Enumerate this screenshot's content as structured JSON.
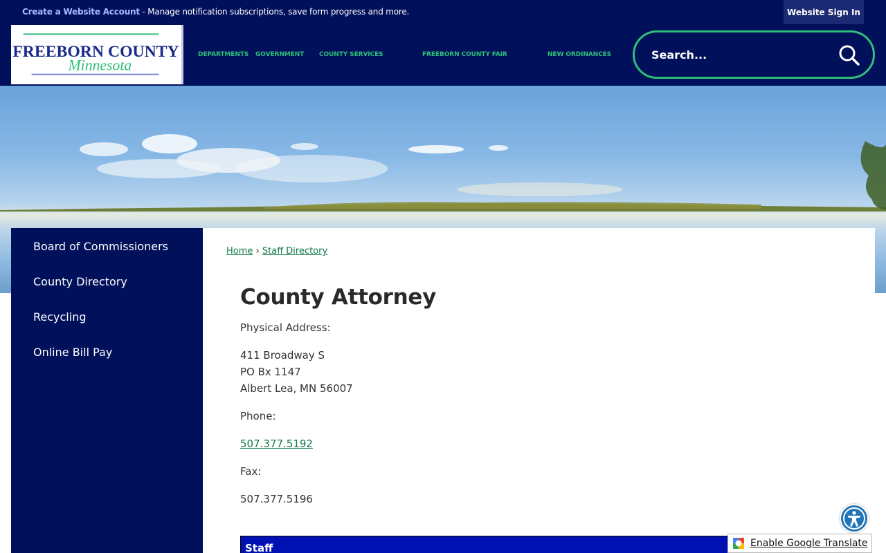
{
  "topbar": {
    "create_account": "Create a Website Account",
    "message": " - Manage notification subscriptions, save form progress and more.",
    "sign_in": "Website Sign In"
  },
  "logo": {
    "line1": "FREEBORN COUNTY",
    "line2": "Minnesota"
  },
  "nav": {
    "items": [
      "DEPARTMENTS",
      "GOVERNMENT",
      "COUNTY SERVICES",
      "FREEBORN COUNTY FAIR",
      "NEW ORDINANCES"
    ]
  },
  "search": {
    "placeholder": "Search..."
  },
  "sidebar": {
    "items": [
      {
        "label": "Board of Commissioners"
      },
      {
        "label": "County Directory"
      },
      {
        "label": "Recycling"
      },
      {
        "label": "Online Bill Pay"
      }
    ]
  },
  "breadcrumb": {
    "home": "Home",
    "separator": "›",
    "current": "Staff Directory"
  },
  "page": {
    "title": "County Attorney",
    "physical_address_label": "Physical Address:",
    "address_line1": "411 Broadway S",
    "address_line2": "PO Bx 1147",
    "address_line3": "Albert Lea, MN 56007",
    "phone_label": "Phone:",
    "phone": "507.377.5192",
    "fax_label": "Fax:",
    "fax": "507.377.5196",
    "staff_header": "Staff"
  },
  "translate": {
    "label": "Enable Google Translate"
  },
  "colors": {
    "navy": "#00105a",
    "green": "#2fbf79",
    "link_green": "#127a4a",
    "staff_blue": "#0011b3"
  },
  "icons": {
    "search": "search-icon",
    "accessibility": "accessibility-icon",
    "google": "google-translate-icon"
  }
}
